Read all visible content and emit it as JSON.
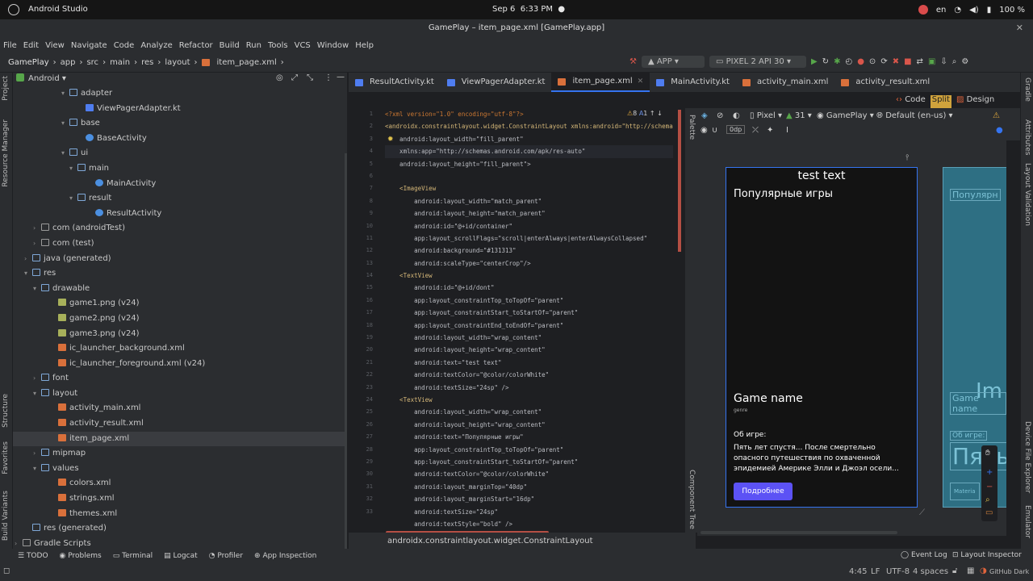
{
  "system": {
    "app_name": "Android Studio",
    "date": "Sep 6",
    "time": "6:33 PM",
    "lang": "en",
    "battery": "100 %"
  },
  "window_title": "GamePlay – item_page.xml [GamePlay.app]",
  "menu": [
    "File",
    "Edit",
    "View",
    "Navigate",
    "Code",
    "Analyze",
    "Refactor",
    "Build",
    "Run",
    "Tools",
    "VCS",
    "Window",
    "Help"
  ],
  "breadcrumbs": [
    "GamePlay",
    "app",
    "src",
    "main",
    "res",
    "layout",
    "item_page.xml"
  ],
  "run_config": "APP",
  "device": "PIXEL 2 API 30",
  "project_view": "Android",
  "tree": [
    {
      "label": "adapter",
      "indent": 60,
      "icon": "folder",
      "arrow": "▾"
    },
    {
      "label": "ViewPagerAdapter.kt",
      "indent": 80,
      "icon": "ktfile",
      "arrow": ""
    },
    {
      "label": "base",
      "indent": 60,
      "icon": "folder",
      "arrow": "▾"
    },
    {
      "label": "BaseActivity",
      "indent": 80,
      "icon": "actfile",
      "arrow": ""
    },
    {
      "label": "ui",
      "indent": 60,
      "icon": "folder",
      "arrow": "▾"
    },
    {
      "label": "main",
      "indent": 70,
      "icon": "folder",
      "arrow": "▾"
    },
    {
      "label": "MainActivity",
      "indent": 92,
      "icon": "actfile",
      "arrow": ""
    },
    {
      "label": "result",
      "indent": 70,
      "icon": "folder",
      "arrow": "▾"
    },
    {
      "label": "ResultActivity",
      "indent": 92,
      "icon": "actfile",
      "arrow": ""
    },
    {
      "label": "com (androidTest)",
      "indent": 25,
      "icon": "pkg",
      "arrow": "›"
    },
    {
      "label": "com (test)",
      "indent": 25,
      "icon": "pkg",
      "arrow": "›"
    },
    {
      "label": "java (generated)",
      "indent": 14,
      "icon": "folder",
      "arrow": "›"
    },
    {
      "label": "res",
      "indent": 14,
      "icon": "folder",
      "arrow": "▾"
    },
    {
      "label": "drawable",
      "indent": 25,
      "icon": "folder",
      "arrow": "▾"
    },
    {
      "label": "game1.png (v24)",
      "indent": 46,
      "icon": "png",
      "arrow": ""
    },
    {
      "label": "game2.png (v24)",
      "indent": 46,
      "icon": "png",
      "arrow": ""
    },
    {
      "label": "game3.png (v24)",
      "indent": 46,
      "icon": "png",
      "arrow": ""
    },
    {
      "label": "ic_launcher_background.xml",
      "indent": 46,
      "icon": "xml",
      "arrow": ""
    },
    {
      "label": "ic_launcher_foreground.xml (v24)",
      "indent": 46,
      "icon": "xml",
      "arrow": ""
    },
    {
      "label": "font",
      "indent": 25,
      "icon": "folder",
      "arrow": "›"
    },
    {
      "label": "layout",
      "indent": 25,
      "icon": "folder",
      "arrow": "▾"
    },
    {
      "label": "activity_main.xml",
      "indent": 46,
      "icon": "xml",
      "arrow": ""
    },
    {
      "label": "activity_result.xml",
      "indent": 46,
      "icon": "xml",
      "arrow": ""
    },
    {
      "label": "item_page.xml",
      "indent": 46,
      "icon": "xml",
      "arrow": "",
      "selected": true
    },
    {
      "label": "mipmap",
      "indent": 25,
      "icon": "folder",
      "arrow": "›"
    },
    {
      "label": "values",
      "indent": 25,
      "icon": "folder",
      "arrow": "▾"
    },
    {
      "label": "colors.xml",
      "indent": 46,
      "icon": "xml",
      "arrow": ""
    },
    {
      "label": "strings.xml",
      "indent": 46,
      "icon": "xml",
      "arrow": ""
    },
    {
      "label": "themes.xml",
      "indent": 46,
      "icon": "xml",
      "arrow": ""
    },
    {
      "label": "res (generated)",
      "indent": 14,
      "icon": "folder",
      "arrow": ""
    },
    {
      "label": "Gradle Scripts",
      "indent": 2,
      "icon": "pkg",
      "arrow": "›"
    }
  ],
  "tabs": [
    {
      "label": "ResultActivity.kt",
      "active": false
    },
    {
      "label": "ViewPagerAdapter.kt",
      "active": false
    },
    {
      "label": "item_page.xml",
      "active": true
    },
    {
      "label": "MainActivity.kt",
      "active": false
    },
    {
      "label": "activity_main.xml",
      "active": false
    },
    {
      "label": "activity_result.xml",
      "active": false
    }
  ],
  "view_modes": [
    "Code",
    "Split",
    "Design"
  ],
  "editor": {
    "warnings": "8",
    "weak_warnings": "1",
    "line_numbers": [
      "1",
      "2",
      "3",
      "4",
      "5",
      "6",
      "7",
      "8",
      "9",
      "10",
      "11",
      "12",
      "13",
      "14",
      "15",
      "16",
      "17",
      "18",
      "19",
      "20",
      "21",
      "22",
      "23",
      "24",
      "25",
      "26",
      "27",
      "28",
      "29",
      "30",
      "31",
      "32",
      "33"
    ],
    "lines": [
      "<?xml version=\"1.0\" encoding=\"utf-8\"?>",
      "<androidx.constraintlayout.widget.ConstraintLayout xmlns:android=\"http://schema",
      "    android:layout_width=\"fill_parent\"",
      "    xmlns:app=\"http://schemas.android.com/apk/res-auto\"",
      "    android:layout_height=\"fill_parent\">",
      "",
      "    <ImageView",
      "        android:layout_width=\"match_parent\"",
      "        android:layout_height=\"match_parent\"",
      "        android:id=\"@+id/container\"",
      "        app:layout_scrollFlags=\"scroll|enterAlways|enterAlwaysCollapsed\"",
      "        android:background=\"#131313\"",
      "        android:scaleType=\"centerCrop\"/>",
      "    <TextView",
      "        android:id=\"@+id/dont\"",
      "        app:layout_constraintTop_toTopOf=\"parent\"",
      "        app:layout_constraintStart_toStartOf=\"parent\"",
      "        app:layout_constraintEnd_toEndOf=\"parent\"",
      "        android:layout_width=\"wrap_content\"",
      "        android:layout_height=\"wrap_content\"",
      "        android:text=\"test text\"",
      "        android:textColor=\"@color/colorWhite\"",
      "        android:textSize=\"24sp\" />",
      "    <TextView",
      "        android:layout_width=\"wrap_content\"",
      "        android:layout_height=\"wrap_content\"",
      "        android:text=\"Популярные игры\"",
      "        app:layout_constraintTop_toTopOf=\"parent\"",
      "        app:layout_constraintStart_toStartOf=\"parent\"",
      "        android:textColor=\"@color/colorWhite\"",
      "        android:layout_marginTop=\"40dp\"",
      "        android:layout_marginStart=\"16dp\"",
      "        android:textSize=\"24sp\"",
      "        android:textStyle=\"bold\" />"
    ],
    "bottom_crumb": "androidx.constraintlayout.widget.ConstraintLayout"
  },
  "design_toolbar": {
    "device": "Pixel",
    "api": "31",
    "theme": "GamePlay",
    "locale": "Default (en-us)",
    "margin": "0dp"
  },
  "preview": {
    "test_text": "test text",
    "popular": "Популярные игры",
    "game_name": "Game name",
    "genre": "genre",
    "about_label": "Об игре:",
    "about_text": "Пять лет спустя... После смертельно опасного путешествия по охваченной эпидемией Америке Элли и Джоэл осели...",
    "button": "Подробнее",
    "blueprint_popular": "Популярн",
    "blueprint_game": "Game name",
    "blueprint_about": "Об игре:",
    "blueprint_big": "Пять",
    "blueprint_im": "Im",
    "blueprint_material": "Materia"
  },
  "side_tools_left": [
    "Project",
    "Resource Manager",
    "Structure",
    "Favorites",
    "Build Variants"
  ],
  "side_tools_right": [
    "Gradle",
    "Attributes",
    "Layout Validation",
    "Device File Explorer",
    "Emulator"
  ],
  "palette_labels": [
    "Palette",
    "Component Tree"
  ],
  "tool_windows": [
    "TODO",
    "Problems",
    "Terminal",
    "Logcat",
    "Profiler",
    "App Inspection"
  ],
  "tool_windows_right": [
    "Event Log",
    "Layout Inspector"
  ],
  "status": {
    "position": "4:45",
    "line_sep": "LF",
    "encoding": "UTF-8",
    "indent": "4 spaces",
    "theme": "GitHub Dark"
  },
  "colors": {
    "accent": "#3574f0",
    "button": "#5c52f5",
    "preview_bg": "#131313",
    "blueprint": "#2e6f83"
  }
}
